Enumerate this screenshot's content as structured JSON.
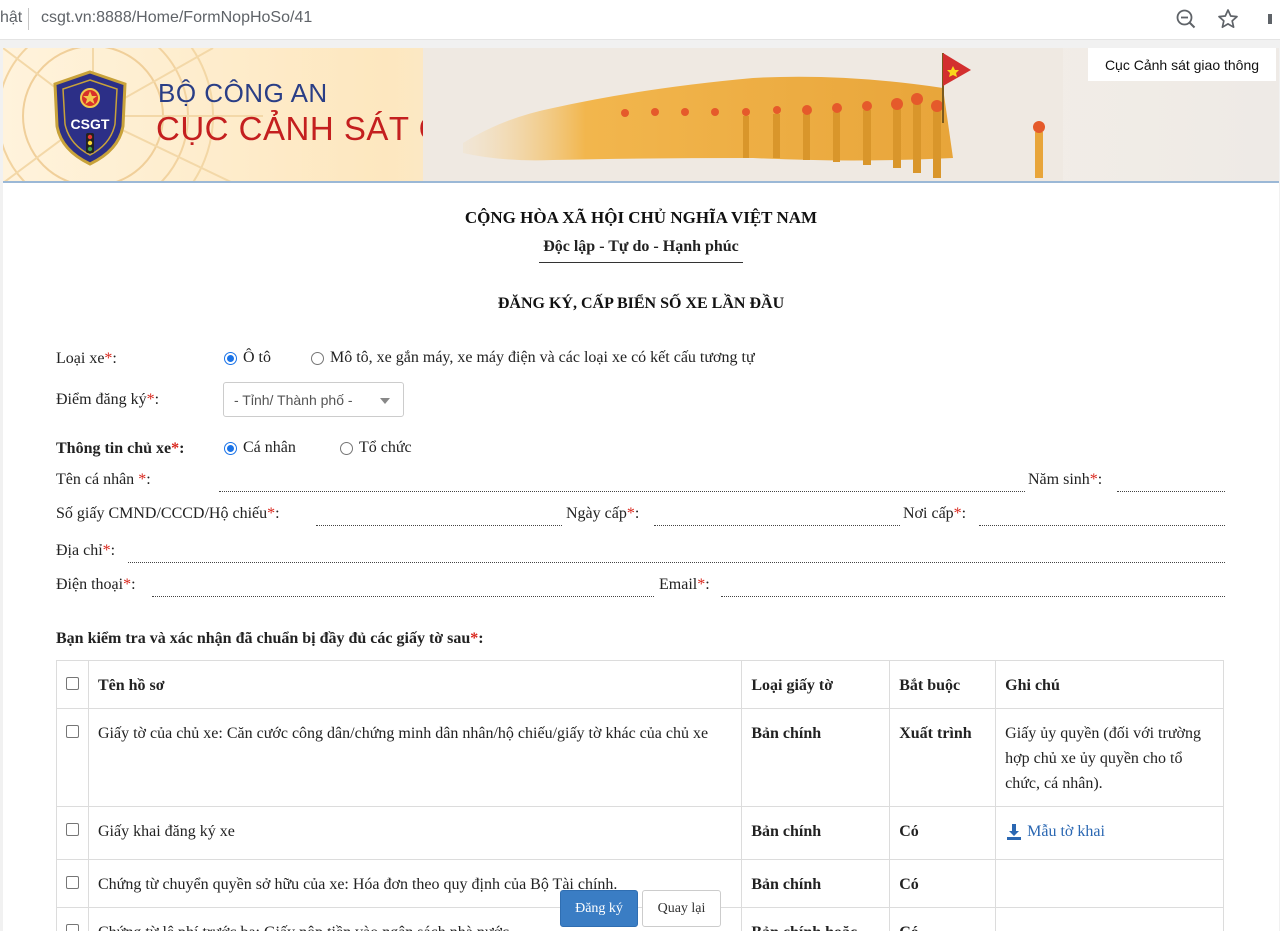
{
  "browser": {
    "left_fragment": "hật",
    "url": "csgt.vn:8888/Home/FormNopHoSo/41",
    "icons": [
      "zoom-out-icon",
      "star-icon"
    ]
  },
  "banner": {
    "org_line1": "BỘ CÔNG AN",
    "org_line2": "CỤC CẢNH SÁT GIAO THÔNG",
    "logo_text": "CSGT",
    "tag": "Cục Cảnh sát giao thông"
  },
  "header": {
    "nation": "CỘNG HÒA XÃ HỘI CHỦ NGHĨA VIỆT NAM",
    "motto": "Độc lập - Tự do - Hạnh phúc",
    "form_title": "ĐĂNG KÝ, CẤP BIỂN SỐ XE LẦN ĐẦU"
  },
  "form": {
    "vehicle_type_label": "Loại xe",
    "vehicle_options": [
      "Ô tô",
      "Mô tô, xe gắn máy, xe máy điện và các loại xe có kết cấu tương tự"
    ],
    "vehicle_selected": "Ô tô",
    "reg_point_label": "Điểm đăng ký",
    "reg_point_placeholder": "- Tỉnh/ Thành phố -",
    "owner_info_label": "Thông tin chủ xe",
    "owner_options": [
      "Cá nhân",
      "Tổ chức"
    ],
    "owner_selected": "Cá nhân",
    "name_label": "Tên cá nhân ",
    "birth_year_label": "Năm sinh",
    "id_label": "Số giấy CMND/CCCD/Hộ chiếu",
    "issue_date_label": "Ngày cấp",
    "issue_place_label": "Nơi cấp",
    "address_label": "Địa chỉ",
    "phone_label": "Điện thoại",
    "email_label": "Email",
    "required_mark": "*",
    "colon": ":"
  },
  "documents": {
    "heading": "Bạn kiểm tra và xác nhận đã chuẩn bị đầy đủ các giấy tờ sau",
    "columns": [
      "Tên hồ sơ",
      "Loại giấy tờ",
      "Bắt buộc",
      "Ghi chú"
    ],
    "rows": [
      {
        "name": "Giấy tờ của chủ xe: Căn cước công dân/chứng minh dân nhân/hộ chiếu/giấy tờ khác của chủ xe",
        "type": "Bản chính",
        "required": "Xuất trình",
        "note": "Giấy ủy quyền (đối với trường hợp chủ xe ủy quyền cho tổ chức, cá nhân)."
      },
      {
        "name": "Giấy khai đăng ký xe",
        "type": "Bản chính",
        "required": "Có",
        "note": "Mẫu tờ khai"
      },
      {
        "name": "Chứng từ chuyển quyền sở hữu của xe: Hóa đơn theo quy định của Bộ Tài chính.",
        "type": "Bản chính",
        "required": "Có",
        "note": ""
      },
      {
        "name": "Chứng từ lệ phí trước bạ: Giấy nộp tiền vào ngân sách nhà nước",
        "type": "Bản chính hoặc",
        "required": "Có",
        "note": ""
      }
    ]
  },
  "buttons": {
    "submit": "Đăng ký",
    "back": "Quay lại"
  },
  "colors": {
    "accent": "#3a7dc4",
    "required": "#d9261c",
    "link": "#2a67b2",
    "org_blue": "#2a3e86",
    "org_red": "#c41f1f"
  }
}
